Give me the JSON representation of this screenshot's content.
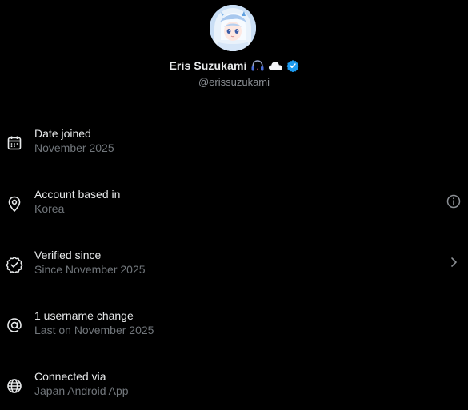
{
  "profile": {
    "display_name": "Eris Suzukami",
    "handle": "@erissuzukami",
    "badges": [
      "headphones-emoji",
      "cloud-emoji",
      "verified-badge-icon"
    ],
    "verified_color": "#1d9bf0"
  },
  "rows": [
    {
      "icon": "calendar-icon",
      "title": "Date joined",
      "subtitle": "November 2025",
      "trailing": null
    },
    {
      "icon": "location-pin-icon",
      "title": "Account based in",
      "subtitle": "Korea",
      "trailing": "info-icon"
    },
    {
      "icon": "verified-check-icon",
      "title": "Verified since",
      "subtitle": "Since November 2025",
      "trailing": "chevron-right-icon"
    },
    {
      "icon": "at-sign-icon",
      "title": "1 username change",
      "subtitle": "Last on November 2025",
      "trailing": null
    },
    {
      "icon": "globe-icon",
      "title": "Connected via",
      "subtitle": "Japan Android App",
      "trailing": null
    }
  ],
  "colors": {
    "background": "#000000",
    "primary_text": "#e7e9ea",
    "secondary_text": "#71767b"
  }
}
